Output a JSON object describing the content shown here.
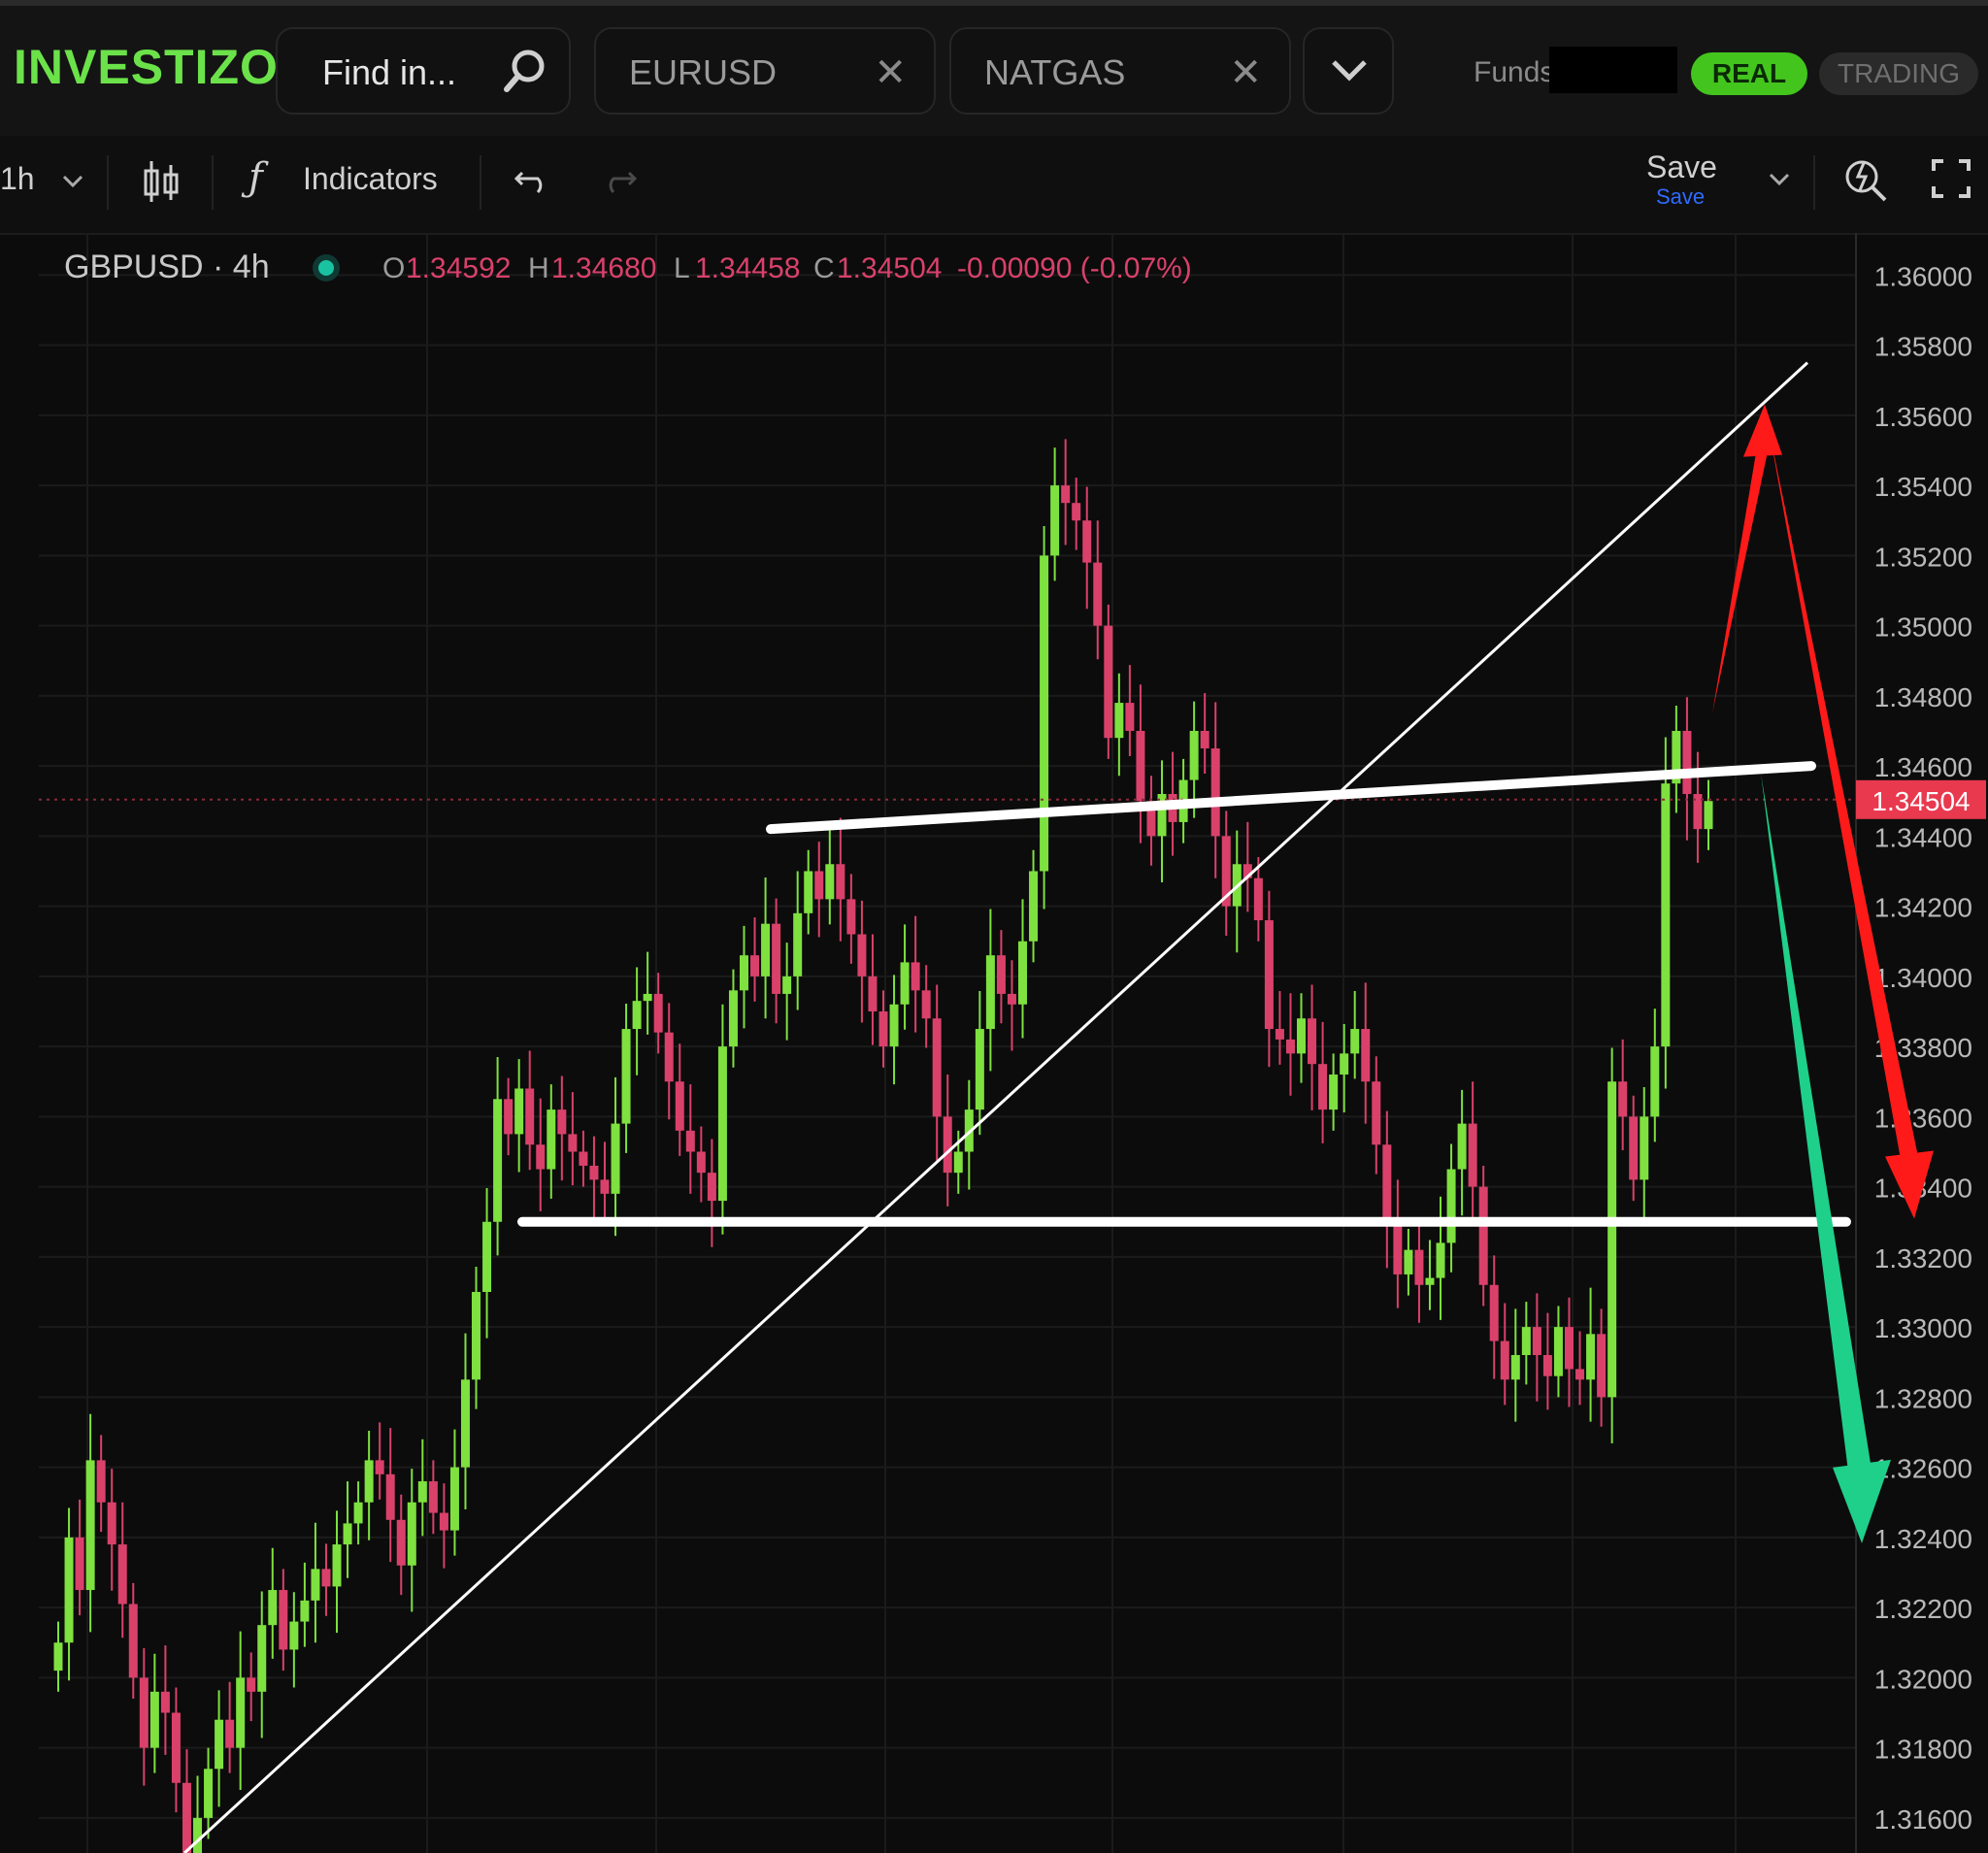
{
  "app": {
    "logo_text": "INVESTIZO",
    "search_placeholder": "Find in...",
    "tabs": [
      "EURUSD",
      "NATGAS"
    ],
    "funds_label": "Funds",
    "mode_real": "REAL",
    "mode_trading": "TRADING"
  },
  "toolbar": {
    "interval": "1h",
    "indicators_label": "Indicators",
    "save_label": "Save",
    "save_sub_label": "Save"
  },
  "legend": {
    "symbol": "GBPUSD · 4h",
    "o_label": "O",
    "o": "1.34592",
    "h_label": "H",
    "h": "1.34680",
    "l_label": "L",
    "l": "1.34458",
    "c_label": "C",
    "c": "1.34504",
    "change": "-0.00090 (-0.07%)"
  },
  "colors": {
    "up": "#7ee13f",
    "down": "#d9416b",
    "accent_green": "#43c51e",
    "price_tag": "#e8394f",
    "arrow_red": "#ff1a1a",
    "arrow_green": "#1fd08a"
  },
  "chart_data": {
    "type": "candlestick",
    "symbol": "GBPUSD",
    "timeframe": "4h",
    "ylim": [
      1.315,
      1.3612
    ],
    "y_ticks": [
      "1.36000",
      "1.35800",
      "1.35600",
      "1.35400",
      "1.35200",
      "1.35000",
      "1.34800",
      "1.34600",
      "1.34400",
      "1.34200",
      "1.34000",
      "1.33800",
      "1.33600",
      "1.33400",
      "1.33200",
      "1.33000",
      "1.32800",
      "1.32600",
      "1.32400",
      "1.32200",
      "1.32000",
      "1.31800",
      "1.31600"
    ],
    "last_price": "1.34504",
    "close_path": [
      1.321,
      1.324,
      1.3225,
      1.3262,
      1.325,
      1.3238,
      1.3221,
      1.32,
      1.318,
      1.3196,
      1.319,
      1.317,
      1.315,
      1.316,
      1.3174,
      1.3188,
      1.318,
      1.32,
      1.3196,
      1.3215,
      1.3225,
      1.3208,
      1.3216,
      1.3222,
      1.3231,
      1.3226,
      1.3238,
      1.3244,
      1.325,
      1.3262,
      1.3258,
      1.3245,
      1.3232,
      1.325,
      1.3256,
      1.3247,
      1.3242,
      1.326,
      1.3285,
      1.331,
      1.333,
      1.3365,
      1.3355,
      1.3368,
      1.3352,
      1.3345,
      1.3362,
      1.3355,
      1.335,
      1.3346,
      1.3342,
      1.3338,
      1.3358,
      1.3385,
      1.3393,
      1.3395,
      1.3384,
      1.337,
      1.3356,
      1.335,
      1.3344,
      1.3336,
      1.338,
      1.3396,
      1.3406,
      1.34,
      1.3415,
      1.3395,
      1.34,
      1.3418,
      1.343,
      1.3422,
      1.3432,
      1.3422,
      1.3412,
      1.34,
      1.339,
      1.338,
      1.3392,
      1.3404,
      1.3396,
      1.3388,
      1.336,
      1.3344,
      1.335,
      1.3362,
      1.3385,
      1.3406,
      1.3395,
      1.3392,
      1.341,
      1.343,
      1.352,
      1.354,
      1.3535,
      1.353,
      1.3518,
      1.35,
      1.3468,
      1.3478,
      1.347,
      1.345,
      1.344,
      1.3452,
      1.3444,
      1.3456,
      1.347,
      1.3465,
      1.344,
      1.342,
      1.3432,
      1.3428,
      1.3416,
      1.3385,
      1.3382,
      1.3378,
      1.3388,
      1.3375,
      1.3362,
      1.3372,
      1.3378,
      1.3385,
      1.337,
      1.3352,
      1.333,
      1.3315,
      1.3322,
      1.3312,
      1.3314,
      1.3324,
      1.3345,
      1.3358,
      1.334,
      1.3312,
      1.3296,
      1.3285,
      1.3292,
      1.33,
      1.3292,
      1.3286,
      1.33,
      1.3288,
      1.3285,
      1.3298,
      1.328,
      1.337,
      1.336,
      1.3342,
      1.336,
      1.338,
      1.3455,
      1.347,
      1.3452,
      1.3442,
      1.345
    ]
  },
  "annotations": {
    "upper_line": {
      "start": 1.3442,
      "end": 1.346
    },
    "lower_line": {
      "level": 1.333
    },
    "trend_line": {
      "start": 1.315,
      "end": 1.3575
    },
    "red_arrow": {
      "from": 1.3475,
      "peak": 1.3562,
      "to": 1.3332
    },
    "green_arrow": {
      "from": 1.3458,
      "to": 1.324
    }
  }
}
